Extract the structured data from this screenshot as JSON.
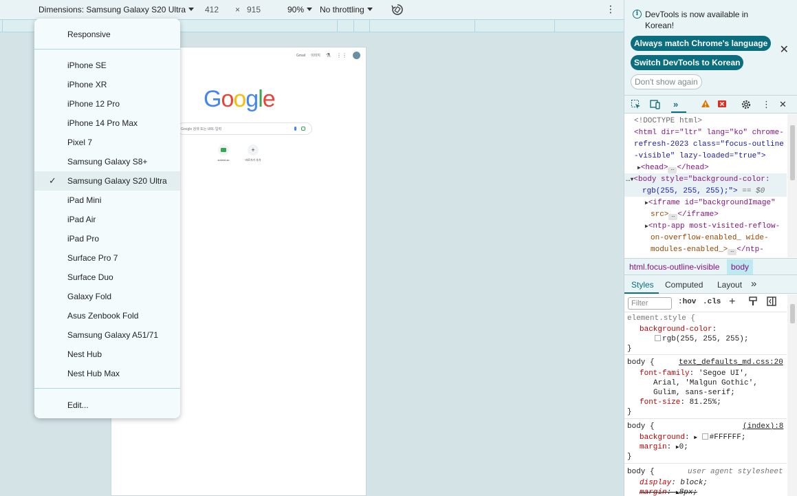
{
  "toolbar": {
    "dimensions_label": "Dimensions: Samsung Galaxy S20 Ultra",
    "width": "412",
    "times": "×",
    "height": "915",
    "zoom": "90%",
    "throttling": "No throttling",
    "more": "⋮"
  },
  "page": {
    "top_links": [
      "Gmail",
      "이미지"
    ],
    "avatar": "",
    "logo_letters": [
      {
        "ch": "G",
        "color": "#4285f4"
      },
      {
        "ch": "o",
        "color": "#ea4335"
      },
      {
        "ch": "o",
        "color": "#fbbc05"
      },
      {
        "ch": "g",
        "color": "#4285f4"
      },
      {
        "ch": "l",
        "color": "#34a853"
      },
      {
        "ch": "e",
        "color": "#ea4335"
      }
    ],
    "search_placeholder": "Google 검색 또는 URL 입력",
    "shortcuts": [
      {
        "label": "solved.ac",
        "icon": "favicon"
      },
      {
        "label": "바로가기 추가",
        "icon": "+"
      }
    ]
  },
  "device_menu": {
    "responsive": "Responsive",
    "devices": [
      "iPhone SE",
      "iPhone XR",
      "iPhone 12 Pro",
      "iPhone 14 Pro Max",
      "Pixel 7",
      "Samsung Galaxy S8+",
      "Samsung Galaxy S20 Ultra",
      "iPad Mini",
      "iPad Air",
      "iPad Pro",
      "Surface Pro 7",
      "Surface Duo",
      "Galaxy Fold",
      "Asus Zenbook Fold",
      "Samsung Galaxy A51/71",
      "Nest Hub",
      "Nest Hub Max"
    ],
    "selected": "Samsung Galaxy S20 Ultra",
    "checkmark": "✓",
    "edit": "Edit..."
  },
  "devtools": {
    "info": {
      "message": "DevTools is now available in Korean!",
      "btn_match": "Always match Chrome's language",
      "btn_switch": "Switch DevTools to Korean",
      "btn_dont_show": "Don't show again",
      "close": "✕"
    },
    "dom_lines": [
      "<!DOCTYPE html>",
      "<html dir=\"ltr\" lang=\"ko\" chrome-",
      "refresh-2023 class=\"focus-outline",
      "-visible\" lazy-loaded=\"true\">",
      "<head>",
      "</head>",
      "<body style=\"background-color:",
      "rgb(255, 255, 255);\">",
      "== $0",
      "<iframe id=\"backgroundImage\"",
      "src>",
      "</iframe>",
      "<ntp-app most-visited-reflow-",
      "on-overflow-enabled_ wide-",
      "modules-enabled_>",
      "</ntp-"
    ],
    "breadcrumbs": [
      "html.focus-outline-visible",
      "body"
    ],
    "style_tabs": [
      "Styles",
      "Computed",
      "Layout",
      "»"
    ],
    "filter_placeholder": "Filter",
    "hov": ":hov",
    "cls": ".cls",
    "rules": {
      "element_style": "element.style {",
      "bg_prop": "background-color",
      "bg_val": "rgb(255, 255, 255);",
      "close": "}",
      "body1_sel": "body {",
      "body1_src": "text_defaults_md.css:20",
      "ff_prop": "font-family",
      "ff_val1": "'Segoe UI',",
      "ff_val2": "Arial, 'Malgun Gothic',",
      "ff_val3": "Gulim, sans-serif;",
      "fs_prop": "font-size",
      "fs_val": "81.25%;",
      "body2_sel": "body {",
      "body2_src": "(index):8",
      "bgs_prop": "background",
      "bgs_val": "#FFFFFF;",
      "margin_prop": "margin",
      "margin_val": "0;",
      "body3_sel": "body {",
      "body3_src": "user agent stylesheet",
      "disp_prop": "display",
      "disp_val": "block;",
      "m8_prop": "margin",
      "m8_val": "8px;"
    }
  }
}
